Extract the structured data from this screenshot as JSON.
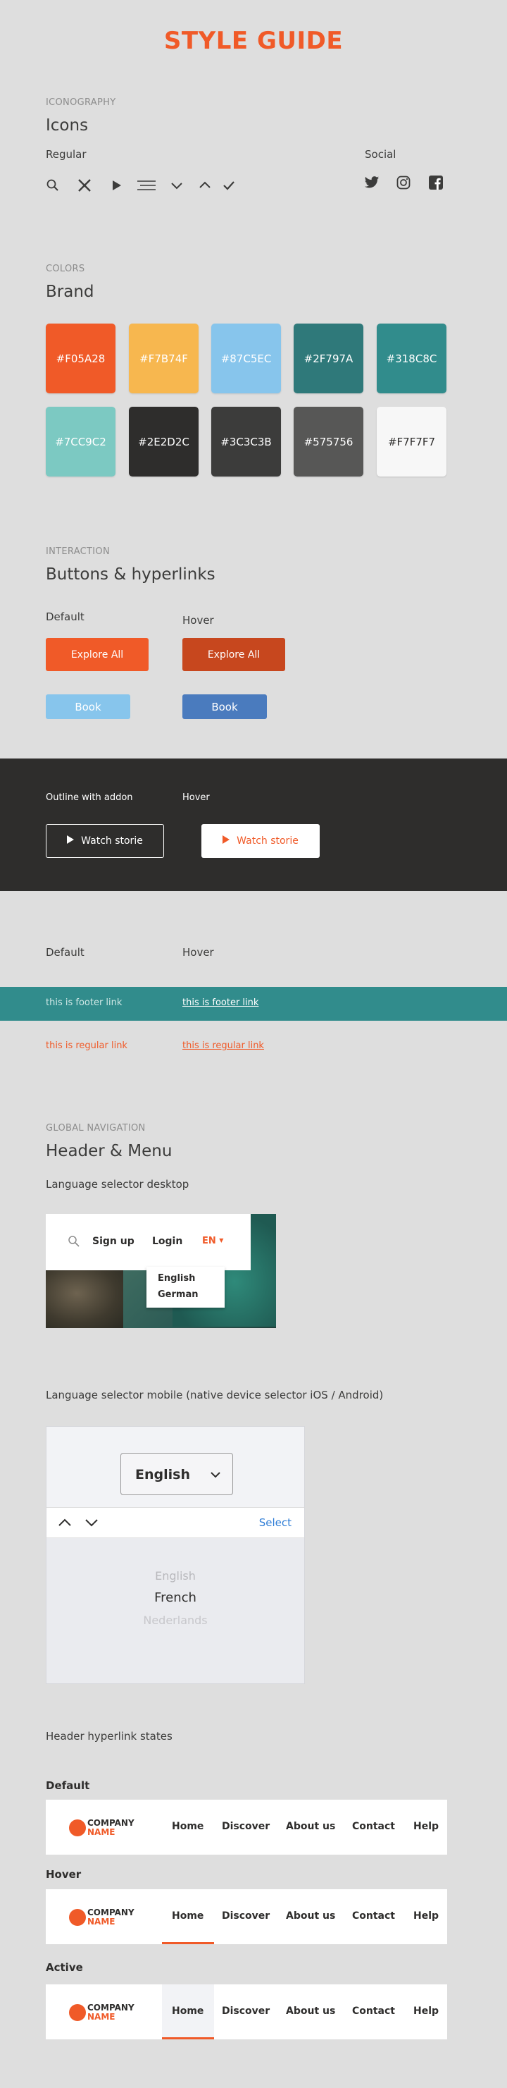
{
  "title": "STYLE GUIDE",
  "iconography": {
    "eyebrow": "ICONOGRAPHY",
    "heading": "Icons",
    "regular_label": "Regular",
    "social_label": "Social",
    "regular_icons": [
      "search-icon",
      "close-icon",
      "play-icon",
      "menu-icon",
      "chevron-down-icon",
      "chevron-up-icon",
      "check-icon"
    ],
    "social_icons": [
      "twitter-icon",
      "instagram-icon",
      "facebook-icon"
    ]
  },
  "colors": {
    "eyebrow": "COLORS",
    "heading": "Brand",
    "swatches": [
      {
        "label": "#F05A28",
        "color": "#F05A28"
      },
      {
        "label": "#F7B74F",
        "color": "#F7B74F"
      },
      {
        "label": "#87C5EC",
        "color": "#87C5EC"
      },
      {
        "label": "#2F797A",
        "color": "#2F797A"
      },
      {
        "label": "#318C8C",
        "color": "#318C8C"
      },
      {
        "label": "#7CC9C2",
        "color": "#7CC9C2"
      },
      {
        "label": "#2E2D2C",
        "color": "#2E2D2C"
      },
      {
        "label": "#3C3C3B",
        "color": "#3C3C3B"
      },
      {
        "label": "#575756",
        "color": "#575756"
      },
      {
        "label": "#F7F7F7",
        "color": "#F7F7F7"
      }
    ]
  },
  "interaction": {
    "eyebrow": "INTERACTION",
    "heading": "Buttons & hyperlinks",
    "default_label": "Default",
    "hover_label": "Hover",
    "explore_default": "Explore All",
    "explore_hover": "Explore All",
    "book_default": "Book",
    "book_hover": "Book",
    "outline_label": "Outline with addon",
    "outline_hover_label": "Hover",
    "watch_default": "Watch storie",
    "watch_hover": "Watch storie",
    "links_default_label": "Default",
    "links_hover_label": "Hover",
    "footer_link": "this is footer link",
    "footer_link_hover": "this is footer link",
    "regular_link": "this is regular link",
    "regular_link_hover": "this is regular link"
  },
  "navigation": {
    "eyebrow": "GLOBAL NAVIGATION",
    "heading": "Header & Menu",
    "lang_desktop_label": "Language selector desktop",
    "desktop": {
      "signup": "Sign up",
      "login": "Login",
      "lang": "EN",
      "options": [
        "English",
        "German"
      ]
    },
    "lang_mobile_label": "Language selector mobile (native device selector iOS / Android)",
    "mobile": {
      "selected": "English",
      "select_action": "Select",
      "options": [
        "English",
        "French",
        "Nederlands"
      ]
    },
    "header_states_label": "Header hyperlink states",
    "states": [
      {
        "label": "Default"
      },
      {
        "label": "Hover"
      },
      {
        "label": "Active"
      }
    ],
    "logo_line1": "COMPANY",
    "logo_line2": "NAME",
    "menu": [
      "Home",
      "Discover",
      "About us",
      "Contact",
      "Help"
    ]
  }
}
